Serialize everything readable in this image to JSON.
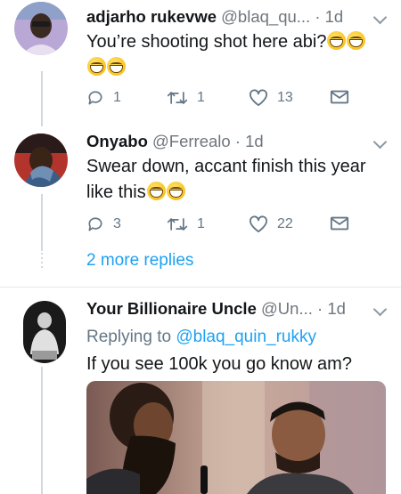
{
  "tweets": [
    {
      "name": "adjarho rukevwe",
      "handle": "@blaq_qu...",
      "time": "· 1d",
      "text": "You’re shooting shot here abi?",
      "emoji": [
        "grinning-squinting-face",
        "grinning-squinting-face",
        "grinning-squinting-face",
        "grinning-squinting-face"
      ],
      "replies": "1",
      "retweets": "1",
      "likes": "13"
    },
    {
      "name": "Onyabo",
      "handle": "@Ferrealo",
      "time": "· 1d",
      "text": "Swear down, accant finish this year like this",
      "emoji": [
        "grinning-squinting-face",
        "grinning-squinting-face"
      ],
      "replies": "3",
      "retweets": "1",
      "likes": "22"
    },
    {
      "name": "Your Billionaire Uncle",
      "handle": "@Un...",
      "time": "· 1d",
      "replying_label": "Replying to",
      "replying_handle": "@blaq_quin_rukky",
      "text": "If you see 100k you go know am?"
    }
  ],
  "more_replies": "2 more replies",
  "colors": {
    "accent": "#1da1f2",
    "muted": "#657786",
    "divider": "#e1e8ed"
  }
}
